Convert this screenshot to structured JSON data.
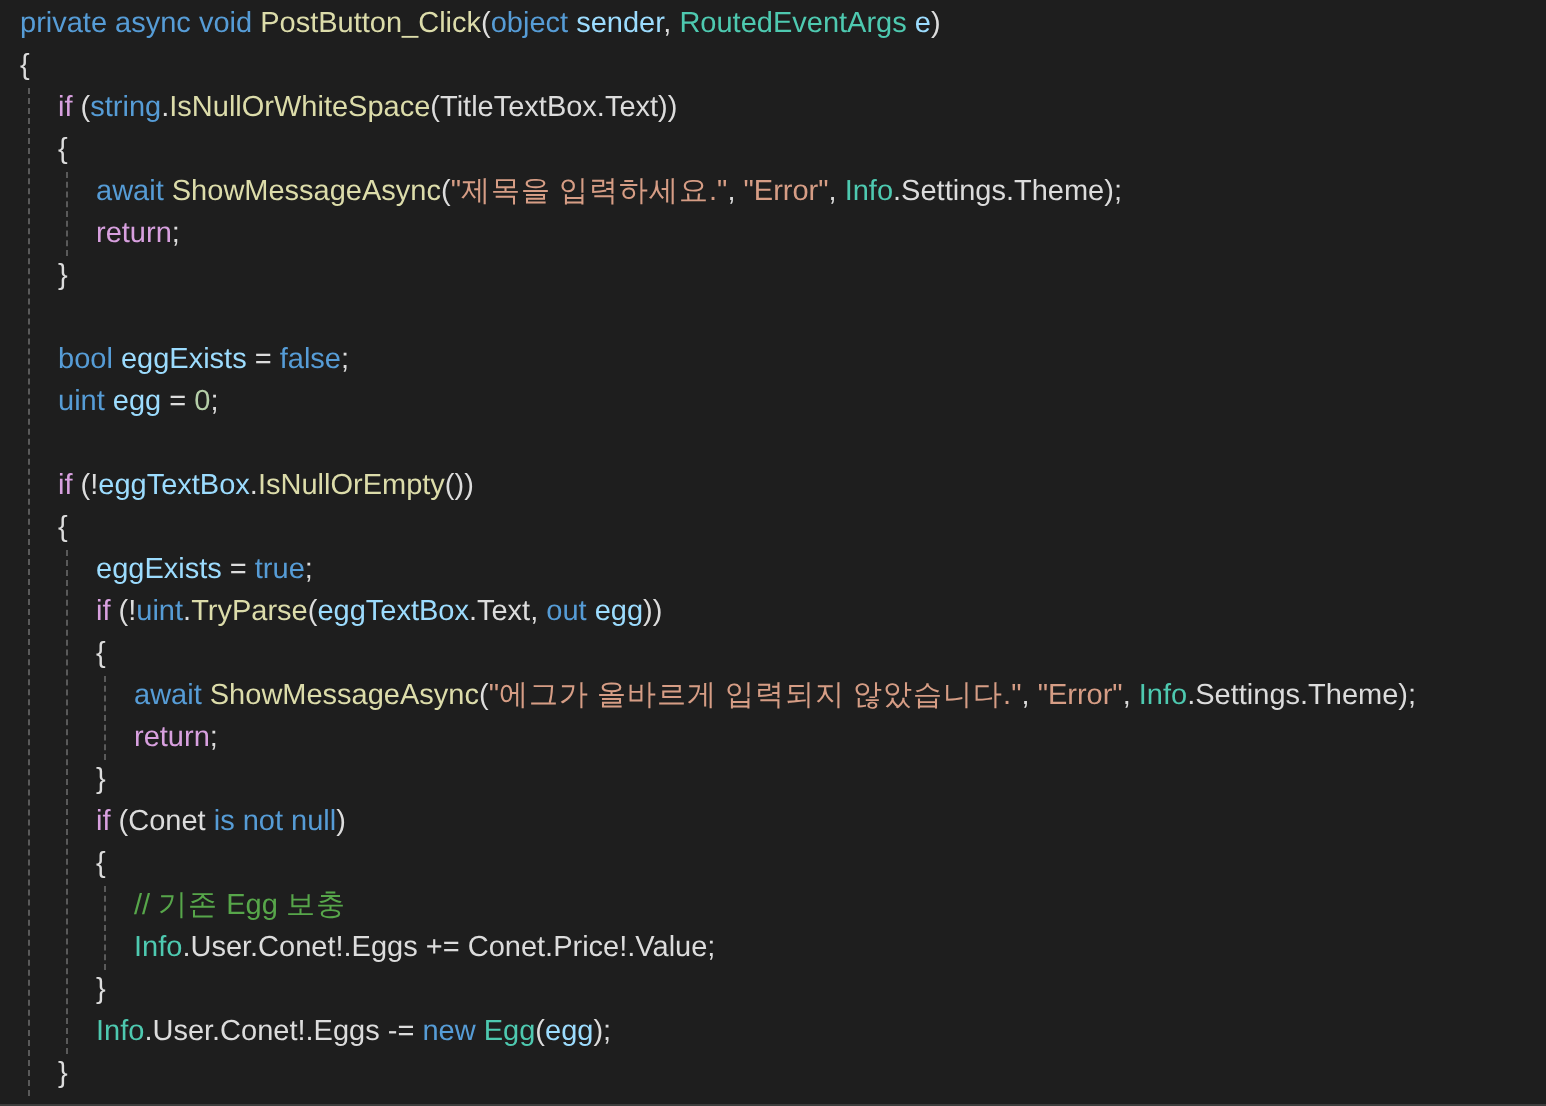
{
  "editor": {
    "lines": [
      {
        "kind": "code",
        "tokens": [
          {
            "text": "private async void ",
            "kind": "keyword"
          },
          {
            "text": "PostButton_Click",
            "kind": "method"
          },
          {
            "text": "(",
            "kind": "plain"
          },
          {
            "text": "object ",
            "kind": "keyword"
          },
          {
            "text": "sender",
            "kind": "variable"
          },
          {
            "text": ", ",
            "kind": "plain"
          },
          {
            "text": "RoutedEventArgs ",
            "kind": "type"
          },
          {
            "text": "e",
            "kind": "variable"
          },
          {
            "text": ")",
            "kind": "plain"
          }
        ]
      },
      {
        "kind": "code",
        "tokens": [
          {
            "text": "{",
            "kind": "plain"
          }
        ],
        "children": [
          {
            "kind": "code",
            "tokens": [
              {
                "text": "if ",
                "kind": "control"
              },
              {
                "text": "(",
                "kind": "plain"
              },
              {
                "text": "string",
                "kind": "keyword"
              },
              {
                "text": ".",
                "kind": "plain"
              },
              {
                "text": "IsNullOrWhiteSpace",
                "kind": "method"
              },
              {
                "text": "(TitleTextBox.Text))",
                "kind": "plain"
              }
            ]
          },
          {
            "kind": "code",
            "tokens": [
              {
                "text": "{",
                "kind": "plain"
              }
            ],
            "children": [
              {
                "kind": "code",
                "tokens": [
                  {
                    "text": "await ",
                    "kind": "keyword"
                  },
                  {
                    "text": "ShowMessageAsync",
                    "kind": "method"
                  },
                  {
                    "text": "(",
                    "kind": "plain"
                  },
                  {
                    "text": "\"제목을 입력하세요.\"",
                    "kind": "string"
                  },
                  {
                    "text": ", ",
                    "kind": "plain"
                  },
                  {
                    "text": "\"Error\"",
                    "kind": "string"
                  },
                  {
                    "text": ", ",
                    "kind": "plain"
                  },
                  {
                    "text": "Info",
                    "kind": "type"
                  },
                  {
                    "text": ".Settings.Theme);",
                    "kind": "plain"
                  }
                ]
              },
              {
                "kind": "code",
                "tokens": [
                  {
                    "text": "return",
                    "kind": "control"
                  },
                  {
                    "text": ";",
                    "kind": "plain"
                  }
                ]
              }
            ]
          },
          {
            "kind": "code",
            "tokens": [
              {
                "text": "}",
                "kind": "plain"
              }
            ]
          },
          {
            "kind": "blank"
          },
          {
            "kind": "code",
            "tokens": [
              {
                "text": "bool ",
                "kind": "keyword"
              },
              {
                "text": "eggExists",
                "kind": "variable"
              },
              {
                "text": " = ",
                "kind": "plain"
              },
              {
                "text": "false",
                "kind": "keyword"
              },
              {
                "text": ";",
                "kind": "plain"
              }
            ]
          },
          {
            "kind": "code",
            "tokens": [
              {
                "text": "uint ",
                "kind": "keyword"
              },
              {
                "text": "egg",
                "kind": "variable"
              },
              {
                "text": " = ",
                "kind": "plain"
              },
              {
                "text": "0",
                "kind": "number"
              },
              {
                "text": ";",
                "kind": "plain"
              }
            ]
          },
          {
            "kind": "blank"
          },
          {
            "kind": "code",
            "tokens": [
              {
                "text": "if ",
                "kind": "control"
              },
              {
                "text": "(!",
                "kind": "plain"
              },
              {
                "text": "eggTextBox",
                "kind": "variable"
              },
              {
                "text": ".",
                "kind": "plain"
              },
              {
                "text": "IsNullOrEmpty",
                "kind": "method"
              },
              {
                "text": "())",
                "kind": "plain"
              }
            ]
          },
          {
            "kind": "code",
            "tokens": [
              {
                "text": "{",
                "kind": "plain"
              }
            ],
            "children": [
              {
                "kind": "code",
                "tokens": [
                  {
                    "text": "eggExists",
                    "kind": "variable"
                  },
                  {
                    "text": " = ",
                    "kind": "plain"
                  },
                  {
                    "text": "true",
                    "kind": "keyword"
                  },
                  {
                    "text": ";",
                    "kind": "plain"
                  }
                ]
              },
              {
                "kind": "code",
                "tokens": [
                  {
                    "text": "if ",
                    "kind": "control"
                  },
                  {
                    "text": "(!",
                    "kind": "plain"
                  },
                  {
                    "text": "uint",
                    "kind": "keyword"
                  },
                  {
                    "text": ".",
                    "kind": "plain"
                  },
                  {
                    "text": "TryParse",
                    "kind": "method"
                  },
                  {
                    "text": "(",
                    "kind": "plain"
                  },
                  {
                    "text": "eggTextBox",
                    "kind": "variable"
                  },
                  {
                    "text": ".Text, ",
                    "kind": "plain"
                  },
                  {
                    "text": "out ",
                    "kind": "keyword"
                  },
                  {
                    "text": "egg",
                    "kind": "variable"
                  },
                  {
                    "text": "))",
                    "kind": "plain"
                  }
                ]
              },
              {
                "kind": "code",
                "tokens": [
                  {
                    "text": "{",
                    "kind": "plain"
                  }
                ],
                "children": [
                  {
                    "kind": "code",
                    "tokens": [
                      {
                        "text": "await ",
                        "kind": "keyword"
                      },
                      {
                        "text": "ShowMessageAsync",
                        "kind": "method"
                      },
                      {
                        "text": "(",
                        "kind": "plain"
                      },
                      {
                        "text": "\"에그가 올바르게 입력되지 않았습니다.\"",
                        "kind": "string"
                      },
                      {
                        "text": ", ",
                        "kind": "plain"
                      },
                      {
                        "text": "\"Error\"",
                        "kind": "string"
                      },
                      {
                        "text": ", ",
                        "kind": "plain"
                      },
                      {
                        "text": "Info",
                        "kind": "type"
                      },
                      {
                        "text": ".Settings.Theme);",
                        "kind": "plain"
                      }
                    ]
                  },
                  {
                    "kind": "code",
                    "tokens": [
                      {
                        "text": "return",
                        "kind": "control"
                      },
                      {
                        "text": ";",
                        "kind": "plain"
                      }
                    ]
                  }
                ]
              },
              {
                "kind": "code",
                "tokens": [
                  {
                    "text": "}",
                    "kind": "plain"
                  }
                ]
              },
              {
                "kind": "code",
                "tokens": [
                  {
                    "text": "if ",
                    "kind": "control"
                  },
                  {
                    "text": "(Conet ",
                    "kind": "plain"
                  },
                  {
                    "text": "is not null",
                    "kind": "keyword"
                  },
                  {
                    "text": ")",
                    "kind": "plain"
                  }
                ]
              },
              {
                "kind": "code",
                "tokens": [
                  {
                    "text": "{",
                    "kind": "plain"
                  }
                ],
                "children": [
                  {
                    "kind": "code",
                    "tokens": [
                      {
                        "text": "// 기존 Egg 보충",
                        "kind": "comment"
                      }
                    ]
                  },
                  {
                    "kind": "code",
                    "tokens": [
                      {
                        "text": "Info",
                        "kind": "type"
                      },
                      {
                        "text": ".User.Conet!.Eggs += Conet.Price!.Value;",
                        "kind": "plain"
                      }
                    ]
                  }
                ]
              },
              {
                "kind": "code",
                "tokens": [
                  {
                    "text": "}",
                    "kind": "plain"
                  }
                ]
              },
              {
                "kind": "code",
                "tokens": [
                  {
                    "text": "Info",
                    "kind": "type"
                  },
                  {
                    "text": ".User.Conet!.Eggs -= ",
                    "kind": "plain"
                  },
                  {
                    "text": "new ",
                    "kind": "keyword"
                  },
                  {
                    "text": "Egg",
                    "kind": "type"
                  },
                  {
                    "text": "(",
                    "kind": "plain"
                  },
                  {
                    "text": "egg",
                    "kind": "variable"
                  },
                  {
                    "text": ");",
                    "kind": "plain"
                  }
                ]
              }
            ]
          },
          {
            "kind": "code",
            "tokens": [
              {
                "text": "}",
                "kind": "plain"
              }
            ]
          }
        ]
      }
    ]
  }
}
